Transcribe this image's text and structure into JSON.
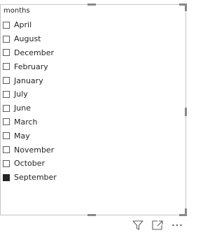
{
  "slicer": {
    "header": "months",
    "items": [
      {
        "label": "April",
        "checked": false
      },
      {
        "label": "August",
        "checked": false
      },
      {
        "label": "December",
        "checked": false
      },
      {
        "label": "February",
        "checked": false
      },
      {
        "label": "January",
        "checked": false
      },
      {
        "label": "July",
        "checked": false
      },
      {
        "label": "June",
        "checked": false
      },
      {
        "label": "March",
        "checked": false
      },
      {
        "label": "May",
        "checked": false
      },
      {
        "label": "November",
        "checked": false
      },
      {
        "label": "October",
        "checked": false
      },
      {
        "label": "September",
        "checked": true
      }
    ]
  },
  "footer": {
    "icons": [
      "filter-icon",
      "focus-mode-icon",
      "more-options-icon"
    ]
  }
}
